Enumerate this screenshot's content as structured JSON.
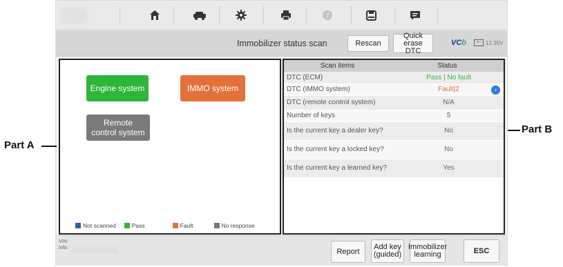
{
  "toolbar": {
    "icons": [
      "home-icon",
      "vehicle-icon",
      "gear-icon",
      "print-icon",
      "help-icon",
      "save-icon",
      "message-icon"
    ]
  },
  "header": {
    "title": "Immobilizer status scan",
    "rescan_label": "Rescan",
    "quick_erase_line1": "Quick erase",
    "quick_erase_line2": "DTC",
    "vci_label": "VC",
    "vci_suffix": "b",
    "voltage": "12.35V"
  },
  "systems": [
    {
      "label_line1": "Engine system",
      "label_line2": "",
      "color": "#2eb53a"
    },
    {
      "label_line1": "IMMO system",
      "label_line2": "",
      "color": "#e5713a"
    },
    {
      "label_line1": "Remote",
      "label_line2": "control system",
      "color": "#7a7a7a"
    }
  ],
  "legend": [
    {
      "label": "Not scanned",
      "color": "#2f5fa8"
    },
    {
      "label": "Pass",
      "color": "#2eb53a"
    },
    {
      "label": "Fault",
      "color": "#e5713a"
    },
    {
      "label": "No response",
      "color": "#7a7a7a"
    }
  ],
  "table": {
    "headers": [
      "Scan items",
      "Status"
    ],
    "rows": [
      {
        "item": "DTC (ECM)",
        "status": "Pass | No fault",
        "status_color": "#3bb34a"
      },
      {
        "item": "DTC (IMMO system)",
        "status": "Fault|2",
        "status_color": "#e5713a"
      },
      {
        "item": "DTC (remote control system)",
        "status": "N/A",
        "status_color": "#666666"
      },
      {
        "item": "Number of keys",
        "status": "5",
        "status_color": "#666666"
      },
      {
        "item": "Is the current key a dealer key?",
        "status": "No",
        "status_color": "#666666"
      },
      {
        "item": "Is the current key a locked key?",
        "status": "No",
        "status_color": "#666666"
      },
      {
        "item": "Is the current key a learned key?",
        "status": "Yes",
        "status_color": "#666666"
      }
    ]
  },
  "footer": {
    "vin_label": "VIN:",
    "info_label": "Info:",
    "report_label": "Report",
    "add_key_line1": "Add key",
    "add_key_line2": "(guided)",
    "immo_line1": "Immobilizer",
    "immo_line2": "learning",
    "esc_label": "ESC"
  },
  "annotations": {
    "part_a": "Part A",
    "part_b": "Part B"
  }
}
